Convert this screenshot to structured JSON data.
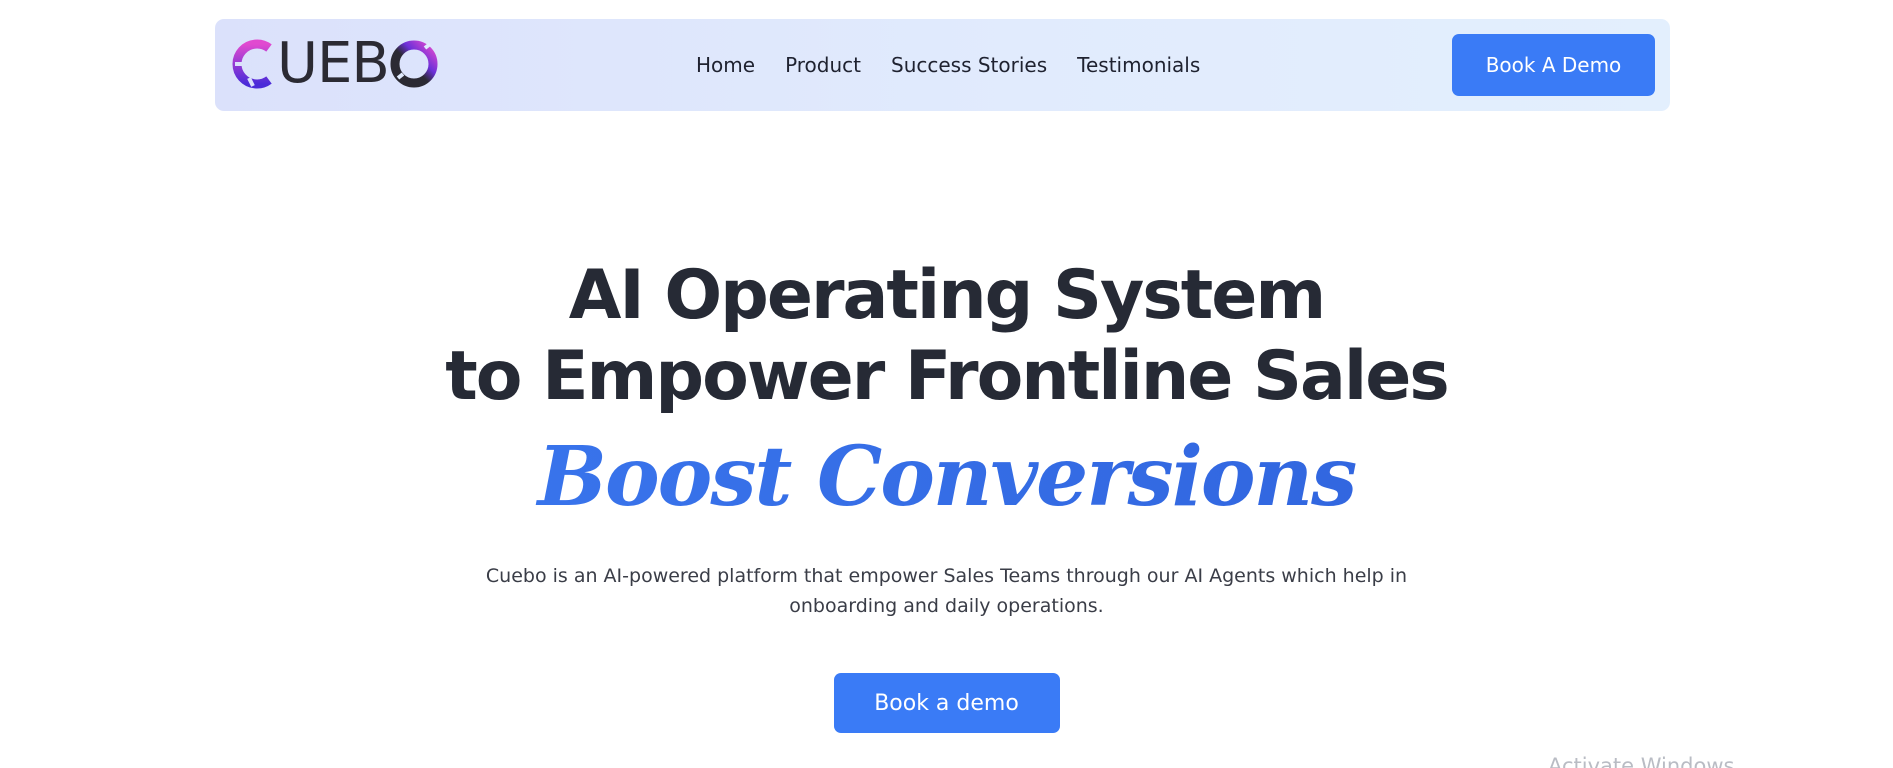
{
  "header": {
    "logo_text": "CUEBO",
    "nav": [
      {
        "label": "Home"
      },
      {
        "label": "Product"
      },
      {
        "label": "Success Stories"
      },
      {
        "label": "Testimonials"
      }
    ],
    "cta_label": "Book A Demo"
  },
  "hero": {
    "title_line1": "AI Operating System",
    "title_line2": "to Empower Frontline Sales",
    "accent": "Boost Conversions",
    "description": "Cuebo is an AI-powered platform that empower Sales Teams through our AI Agents which help in onboarding and daily operations.",
    "cta_label": "Book a demo"
  },
  "overlay": {
    "watermark": "Activate Windows"
  },
  "colors": {
    "accent_blue": "#3a7bf6",
    "heading_dark": "#262a35",
    "logo_gradient_start": "#e14ad0",
    "logo_gradient_end": "#4a2bd8"
  }
}
